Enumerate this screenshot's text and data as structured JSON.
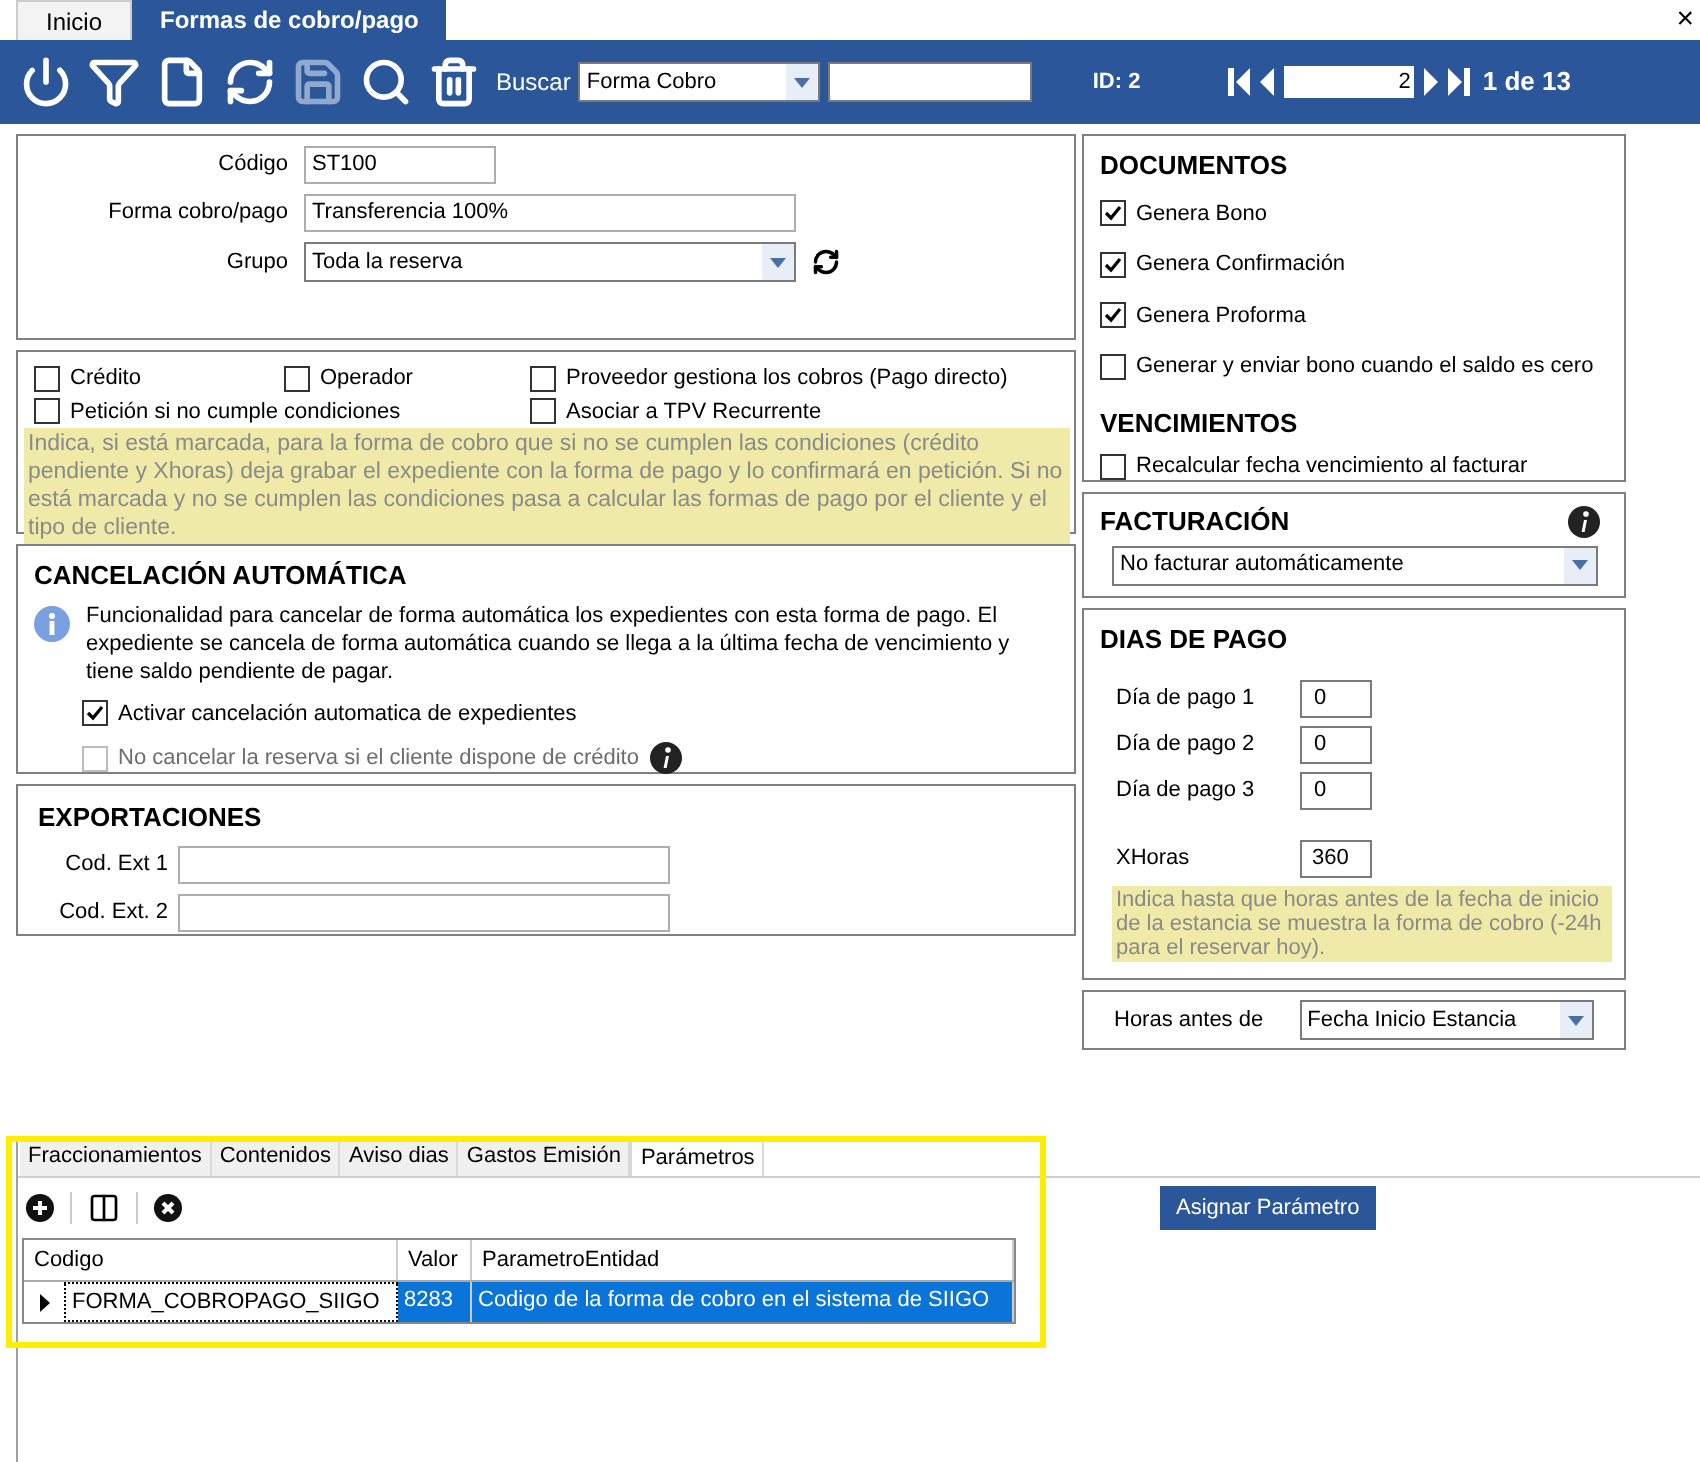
{
  "window": {
    "close": "×"
  },
  "tabs": [
    {
      "label": "Inicio",
      "selected": false
    },
    {
      "label": "Formas de cobro/pago",
      "selected": true
    }
  ],
  "toolbar": {
    "buttons": [
      {
        "kind": "power",
        "disabled": false
      },
      {
        "kind": "filter",
        "disabled": false
      },
      {
        "kind": "new",
        "disabled": false
      },
      {
        "kind": "refresh",
        "disabled": false
      },
      {
        "kind": "save",
        "disabled": true
      },
      {
        "kind": "search",
        "disabled": false
      },
      {
        "kind": "delete",
        "disabled": false
      }
    ],
    "search_label": "Buscar",
    "search_by": "Forma Cobro",
    "id": "ID: 2",
    "page": "2",
    "page_count": "1 de 13"
  },
  "general": {
    "fields": [
      {
        "label": "Código",
        "value": "ST100",
        "kind": "text"
      },
      {
        "label": "Forma cobro/pago",
        "value": "Transferencia 100%",
        "kind": "text"
      },
      {
        "label": "Grupo",
        "value": "Toda la reserva",
        "kind": "select"
      }
    ]
  },
  "options": {
    "rows": [
      [
        {
          "label": "Crédito",
          "checked": false
        },
        {
          "label": "Operador",
          "checked": false
        },
        {
          "label": "Proveedor gestiona los cobros (Pago directo)",
          "checked": false
        }
      ],
      [
        {
          "label": "Petición si no cumple condiciones",
          "checked": false
        },
        null,
        {
          "label": "Asociar a TPV Recurrente",
          "checked": false
        }
      ]
    ],
    "note": "Indica, si está marcada, para la forma de cobro que si no se cumplen las condiciones (crédito pendiente y Xhoras) deja grabar el expediente con la forma de pago y lo confirmará en petición. Si no está marcada y no se cumplen las condiciones pasa a calcular las formas de pago por el cliente y el tipo de cliente."
  },
  "cancelacion": {
    "title": "CANCELACIÓN AUTOMÁTICA",
    "info": "Funcionalidad para cancelar de forma automática los expedientes con esta forma de pago. El expediente se cancela de forma automática cuando se llega a la última fecha de vencimiento y tiene saldo pendiente de pagar.",
    "checks": [
      {
        "label": "Activar cancelación automatica de expedientes",
        "checked": true,
        "disabled": false,
        "info": false
      },
      {
        "label": "No cancelar la reserva si el cliente dispone de crédito",
        "checked": false,
        "disabled": true,
        "info": true
      }
    ]
  },
  "exportaciones": {
    "title": "EXPORTACIONES",
    "fields": [
      {
        "label": "Cod. Ext 1"
      },
      {
        "label": "Cod. Ext. 2"
      }
    ]
  },
  "documentos": {
    "title": "DOCUMENTOS",
    "checks": [
      {
        "label": "Genera Bono",
        "checked": true
      },
      {
        "label": "Genera Confirmación",
        "checked": true
      },
      {
        "label": "Genera Proforma",
        "checked": true
      },
      {
        "label": "Generar y enviar bono cuando el saldo es cero",
        "checked": false
      }
    ],
    "subtitle": "VENCIMIENTOS",
    "sub_checks": [
      {
        "label": "Recalcular fecha vencimiento al facturar",
        "checked": false
      }
    ]
  },
  "facturacion": {
    "title": "FACTURACIÓN",
    "value": "No facturar automáticamente"
  },
  "dias_pago": {
    "title": "DIAS DE PAGO",
    "fields": [
      {
        "label": "Día de pago 1",
        "value": "0"
      },
      {
        "label": "Día de pago 2",
        "value": "0"
      },
      {
        "label": "Día de pago 3",
        "value": "0"
      }
    ],
    "xhoras": {
      "label": "XHoras",
      "value": "360"
    },
    "note": "Indica hasta que horas antes de la fecha de inicio de la estancia se muestra la forma de cobro (-24h para el reservar hoy)."
  },
  "horas_antes": {
    "label": "Horas antes de",
    "value": "Fecha Inicio Estancia"
  },
  "bottom_tabs": [
    {
      "label": "Fraccionamientos",
      "selected": false
    },
    {
      "label": "Contenidos",
      "selected": false
    },
    {
      "label": "Aviso dias",
      "selected": false
    },
    {
      "label": "Gastos Emisión",
      "selected": false
    },
    {
      "label": "Parámetros",
      "selected": true
    }
  ],
  "assign_button": "Asignar Parámetro",
  "table": {
    "columns": [
      "Codigo",
      "Valor",
      "ParametroEntidad"
    ],
    "rows": [
      {
        "cells": [
          "FORMA_COBROPAGO_SIIGO",
          "8283",
          "Codigo de la forma de cobro en el sistema de SIIGO"
        ],
        "selected": true
      }
    ]
  }
}
